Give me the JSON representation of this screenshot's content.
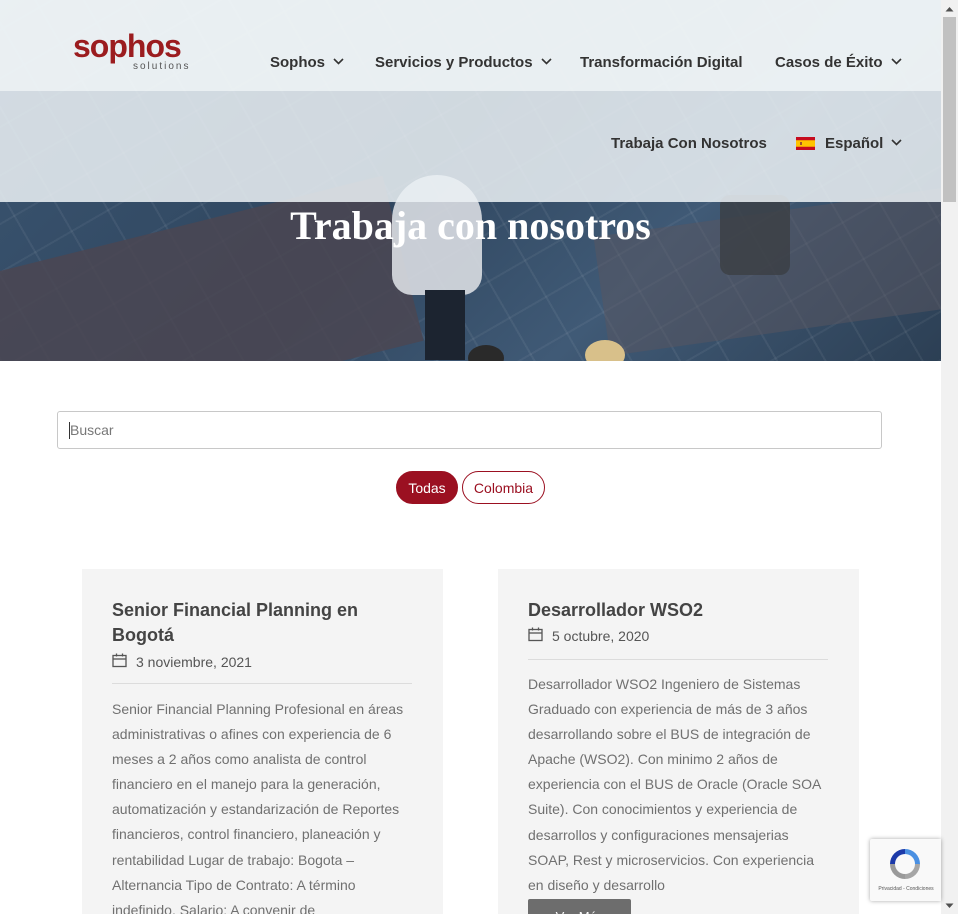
{
  "header": {
    "logo": {
      "text": "sophos",
      "sub": "solutions"
    },
    "nav": [
      {
        "label": "Sophos",
        "dropdown": true
      },
      {
        "label": "Servicios y Productos",
        "dropdown": true
      },
      {
        "label": "Transformación Digital",
        "dropdown": false
      },
      {
        "label": "Casos de Éxito",
        "dropdown": true
      }
    ],
    "nav2": {
      "work_with_us": "Trabaja Con Nosotros",
      "language": "Español"
    }
  },
  "hero": {
    "title": "Trabaja con nosotros"
  },
  "search": {
    "placeholder": "Buscar",
    "value": ""
  },
  "filters": [
    {
      "label": "Todas",
      "active": true
    },
    {
      "label": "Colombia",
      "active": false
    }
  ],
  "cards": [
    {
      "title": "Senior Financial Planning en Bogotá",
      "date": "3 noviembre, 2021",
      "excerpt_lines": [
        "Senior Financial Planning Profesional en áreas",
        "administrativas o afines con experiencia de 6",
        "meses a 2 años como analista de control",
        "financiero en el manejo para la generación,",
        "automatización y estandarización de Reportes",
        "financieros, control financiero, planeación y",
        "rentabilidad Lugar de trabajo: Bogota –",
        "Alternancia Tipo de Contrato: A término",
        "indefinido. Salario: A convenir de"
      ]
    },
    {
      "title": "Desarrollador WSO2",
      "date": "5 octubre, 2020",
      "excerpt_lines": [
        "Desarrollador WSO2 Ingeniero de Sistemas",
        "Graduado con experiencia de más de 3 años",
        "desarrollando sobre el BUS de integración de",
        "Apache (WSO2). Con minimo 2 años de",
        "experiencia con el BUS de Oracle (Oracle SOA",
        "Suite). Con conocimientos y experiencia de",
        "desarrollos y configuraciones mensajerias",
        "SOAP, Rest y microservicios. Con experiencia",
        "en diseño y desarrollo"
      ],
      "read_more": "Ver Más"
    }
  ],
  "recaptcha": {
    "terms": "Privacidad - Condiciones"
  },
  "colors": {
    "brand": "#9b1021",
    "card_bg": "#f4f4f4",
    "text": "#333333"
  }
}
